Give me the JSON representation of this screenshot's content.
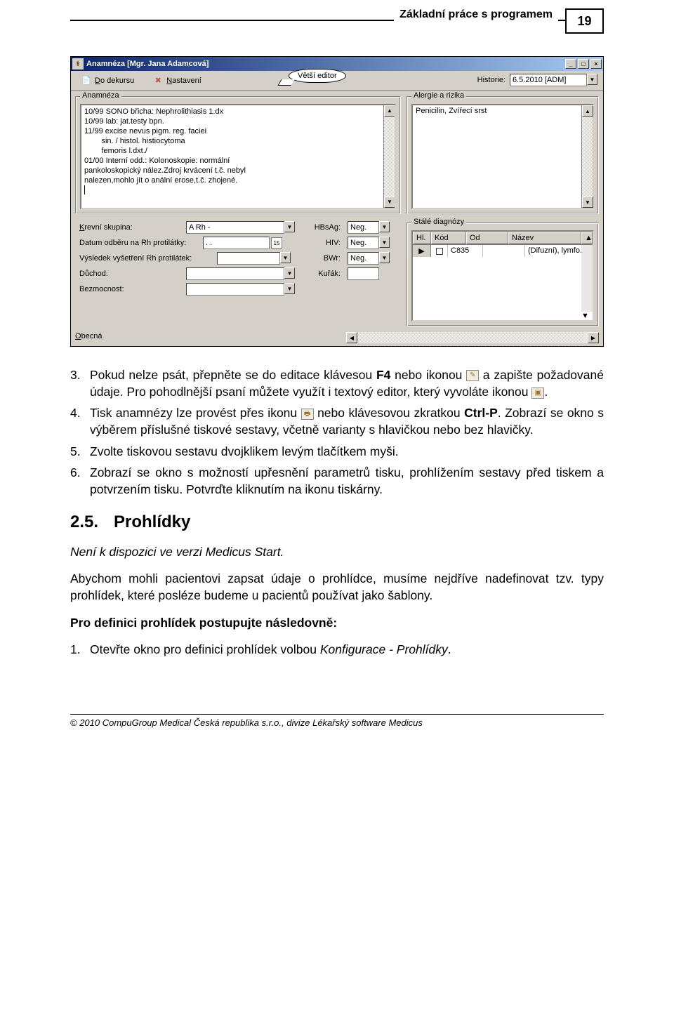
{
  "header": {
    "title": "Základní práce s programem",
    "page_num": "19"
  },
  "window": {
    "title": "Anamnéza [Mgr. Jana Adamcová]",
    "toolbar": {
      "btn_dekurz": {
        "icon": "📄",
        "label_pre": "D",
        "label_rest": "o dekursu"
      },
      "btn_nastaveni": {
        "icon": "✖",
        "label_pre": "N",
        "label_rest": "astavení"
      },
      "balloon": "Větší editor",
      "historie_label": "Historie:",
      "historie_value": "6.5.2010 [ADM]"
    },
    "anamneza_legend": "Anamnéza",
    "anamneza_text_l1": "10/99 SONO břicha: Nephrolithiasis 1.dx",
    "anamneza_text_l2": "10/99 lab: jat.testy bpn.",
    "anamneza_text_l3": "11/99 excise nevus pigm. reg. faciei",
    "anamneza_text_l4": "        sin. / histol. histiocytoma",
    "anamneza_text_l5": "        femoris l.dxt./",
    "anamneza_text_l6": "01/00 Interní odd.: Kolonoskopie: normální",
    "anamneza_text_l7": "pankoloskopický nález.Zdroj krvácení t.č. nebyl",
    "anamneza_text_l8": "nalezen,mohlo jít o anální erose,t.č. zhojené.",
    "alergie_legend": "Alergie a rizika",
    "alergie_text": "Penicilin, Zvířecí srst",
    "fields": {
      "krevni_l": "Krevní skupina:",
      "krevni_v": "A Rh -",
      "rh_l": "Datum odběru na Rh protilátky:",
      "rh_date": ".   .",
      "vys_l": "Výsledek vyšetření Rh protilátek:",
      "duchod_l": "Důchod:",
      "bezmoc_l": "Bezmocnost:",
      "hbsag_l": "HBsAg:",
      "hbsag_v": "Neg.",
      "hiv_l": "HIV:",
      "hiv_v": "Neg.",
      "bwr_l": "BWr:",
      "bwr_v": "Neg.",
      "kurak_l": "Kuřák:"
    },
    "diag": {
      "legend": "Stálé diagnózy",
      "cols": {
        "hl": "Hl.",
        "kod": "Kód",
        "od": "Od",
        "nazev": "Název"
      },
      "row1": {
        "kod": "C835",
        "od": "",
        "nazev": "(Difuzní), lymfo."
      }
    },
    "obecna_label": "Obecná"
  },
  "doc": {
    "li3_a": "3.",
    "li3_b1": "Pokud nelze psát, přepněte se do editace klávesou ",
    "li3_b2": "F4",
    "li3_b3": " nebo ikonou ",
    "li3_b4": " a zapište požadované údaje. Pro pohodlnější psaní můžete využít i textový editor, který vyvoláte ikonou ",
    "li3_b5": ".",
    "li4_a": "4.",
    "li4_b1": "Tisk anamnézy lze provést přes ikonu ",
    "li4_b2": " nebo klávesovou zkratkou ",
    "li4_b3": "Ctrl-P",
    "li4_b4": ". Zobrazí se okno s výběrem příslušné tiskové sestavy, včetně varianty s hlavičkou nebo bez hlavičky.",
    "li5_a": "5.",
    "li5_b": "Zvolte tiskovou sestavu dvojklikem levým tlačítkem myši.",
    "li6_a": "6.",
    "li6_b": "Zobrazí se okno s možností upřesnění parametrů tisku, prohlížením sestavy před tiskem a potvrzením tisku. Potvrďte kliknutím na ikonu tiskárny.",
    "sec_num": "2.5.",
    "sec_title": "Prohlídky",
    "note": "Není k dispozici ve verzi Medicus Start.",
    "p1": "Abychom mohli pacientovi zapsat údaje o prohlídce, musíme nejdříve nadefinovat tzv. typy prohlídek, které posléze budeme u pacientů používat jako šablony.",
    "p2": "Pro definici prohlídek postupujte následovně:",
    "step1_a": "1.",
    "step1_b1": "Otevřte okno pro definici prohlídek volbou ",
    "step1_b2": "Konfigurace - Prohlídky",
    "step1_b3": "."
  },
  "footer": "© 2010 CompuGroup Medical Česká republika s.r.o., divize Lékařský software Medicus"
}
